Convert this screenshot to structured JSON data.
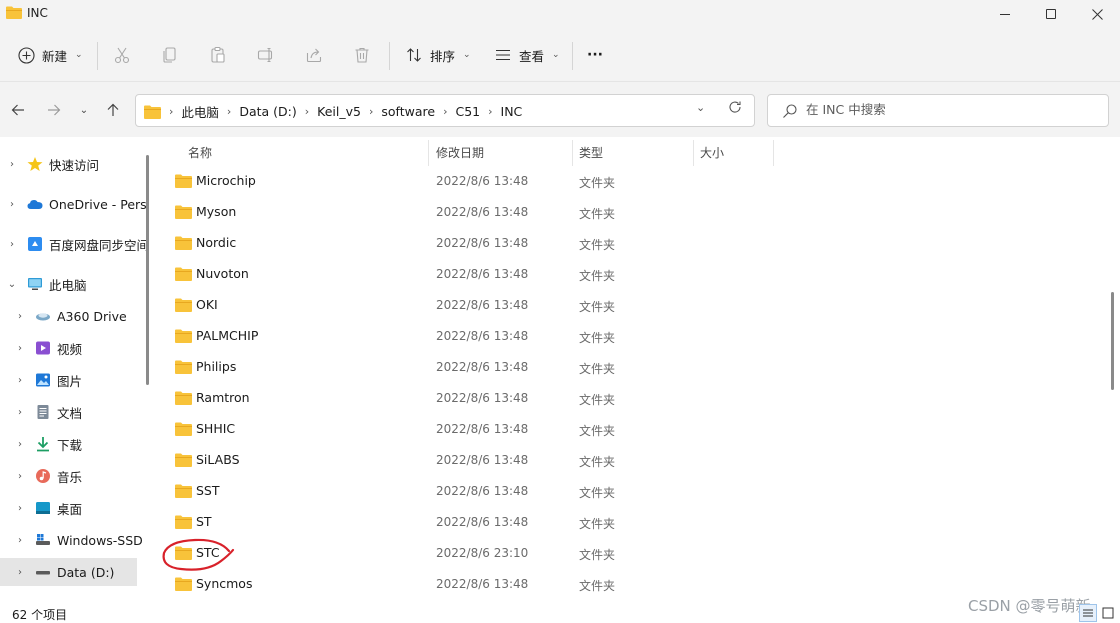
{
  "window": {
    "title": "INC",
    "minimize_icon": "minimize-icon",
    "maximize_icon": "maximize-icon",
    "close_icon": "close-icon"
  },
  "toolbar": {
    "new_label": "新建",
    "sort_label": "排序",
    "view_label": "查看",
    "more_label": "···",
    "icons": [
      "new-icon",
      "cut-icon",
      "copy-icon",
      "paste-icon",
      "rename-icon",
      "share-icon",
      "delete-icon",
      "sort-icon",
      "view-icon",
      "more-icon"
    ]
  },
  "address": {
    "root_label": "此电脑",
    "crumbs": [
      "Data (D:)",
      "Keil_v5",
      "software",
      "C51",
      "INC"
    ]
  },
  "search": {
    "placeholder": "在 INC 中搜索",
    "value": ""
  },
  "nav": {
    "items": [
      {
        "label": "快速访问",
        "icon": "star-icon",
        "expanded": false
      },
      {
        "label": "OneDrive - Pers",
        "icon": "cloud-icon",
        "expanded": false
      },
      {
        "label": "百度网盘同步空间",
        "icon": "baidu-sync-icon",
        "expanded": false
      },
      {
        "label": "此电脑",
        "icon": "this-pc-icon",
        "expanded": true
      },
      {
        "label": "A360 Drive",
        "icon": "drive-icon",
        "expanded": false
      },
      {
        "label": "视频",
        "icon": "video-icon",
        "expanded": false
      },
      {
        "label": "图片",
        "icon": "pictures-icon",
        "expanded": false
      },
      {
        "label": "文档",
        "icon": "documents-icon",
        "expanded": false
      },
      {
        "label": "下载",
        "icon": "download-icon",
        "expanded": false
      },
      {
        "label": "音乐",
        "icon": "music-icon",
        "expanded": false
      },
      {
        "label": "桌面",
        "icon": "desktop-icon",
        "expanded": false
      },
      {
        "label": "Windows-SSD",
        "icon": "disk-icon",
        "expanded": false
      },
      {
        "label": "Data (D:)",
        "icon": "disk-icon",
        "expanded": false,
        "selected": true
      }
    ]
  },
  "columns": {
    "name": "名称",
    "modified": "修改日期",
    "type": "类型",
    "size": "大小"
  },
  "files": [
    {
      "name": "Microchip",
      "modified": "2022/8/6 13:48",
      "type": "文件夹"
    },
    {
      "name": "Myson",
      "modified": "2022/8/6 13:48",
      "type": "文件夹"
    },
    {
      "name": "Nordic",
      "modified": "2022/8/6 13:48",
      "type": "文件夹"
    },
    {
      "name": "Nuvoton",
      "modified": "2022/8/6 13:48",
      "type": "文件夹"
    },
    {
      "name": "OKI",
      "modified": "2022/8/6 13:48",
      "type": "文件夹"
    },
    {
      "name": "PALMCHIP",
      "modified": "2022/8/6 13:48",
      "type": "文件夹"
    },
    {
      "name": "Philips",
      "modified": "2022/8/6 13:48",
      "type": "文件夹"
    },
    {
      "name": "Ramtron",
      "modified": "2022/8/6 13:48",
      "type": "文件夹"
    },
    {
      "name": "SHHIC",
      "modified": "2022/8/6 13:48",
      "type": "文件夹"
    },
    {
      "name": "SiLABS",
      "modified": "2022/8/6 13:48",
      "type": "文件夹"
    },
    {
      "name": "SST",
      "modified": "2022/8/6 13:48",
      "type": "文件夹"
    },
    {
      "name": "ST",
      "modified": "2022/8/6 13:48",
      "type": "文件夹"
    },
    {
      "name": "STC",
      "modified": "2022/8/6 23:10",
      "type": "文件夹",
      "highlighted": true
    },
    {
      "name": "Syncmos",
      "modified": "2022/8/6 13:48",
      "type": "文件夹"
    }
  ],
  "status": {
    "item_count": "62 个项目",
    "watermark": "CSDN @零号萌新"
  },
  "colors": {
    "folder": "#f8c33a",
    "folder_dark": "#e8a820",
    "annotation": "#d8212a",
    "chrome_bg": "#f3f3f3",
    "selected_bg": "#e5e5e5"
  }
}
